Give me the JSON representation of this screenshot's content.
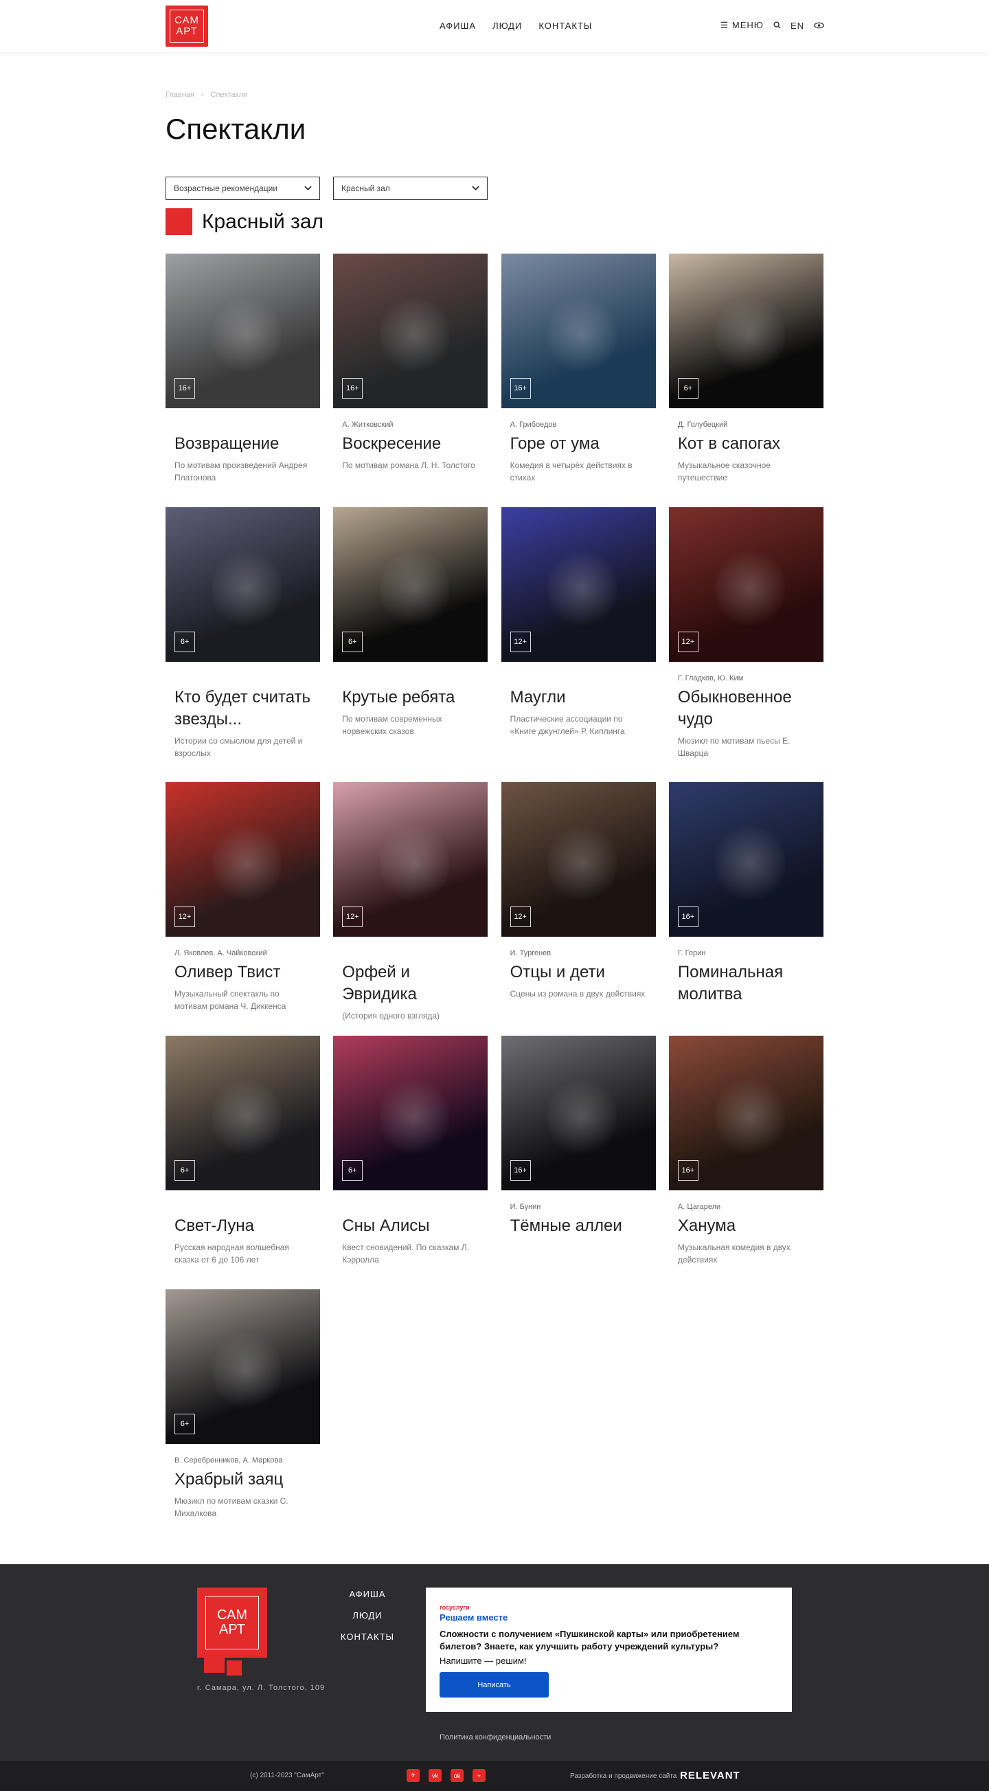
{
  "header": {
    "logo": [
      "САМ",
      "АРТ"
    ],
    "nav": [
      "АФИША",
      "ЛЮДИ",
      "КОНТАКТЫ"
    ],
    "menu": "МЕНЮ",
    "lang": "EN"
  },
  "breadcrumbs": [
    "Главная",
    "Спектакли"
  ],
  "title": "Спектакли",
  "filters": {
    "age": "Возрастные рекомендации",
    "hall": "Красный зал"
  },
  "hall_title": "Красный зал",
  "cards": [
    {
      "age": "16+",
      "author": "",
      "title": "Возвращение",
      "desc": "По мотивам произведений Андрея Платонова",
      "colors": [
        "#3a3a3a",
        "#9ea0a4"
      ]
    },
    {
      "age": "16+",
      "author": "А. Житковский",
      "title": "Воскресение",
      "desc": "По мотивам романа Л. Н. Толстого",
      "colors": [
        "#222628",
        "#6b4a46"
      ]
    },
    {
      "age": "16+",
      "author": "А. Грибоедов",
      "title": "Горе от ума",
      "desc": "Комедия в четырёх действиях в стихах",
      "colors": [
        "#1b3a55",
        "#7b8aa0"
      ]
    },
    {
      "age": "6+",
      "author": "Д. Голубецкий",
      "title": "Кот в сапогах",
      "desc": "Музыкальное сказочное путешествие",
      "colors": [
        "#0a0a0a",
        "#c9b8a3"
      ]
    },
    {
      "age": "6+",
      "author": "",
      "title": "Кто будет считать звезды...",
      "desc": "Истории со смыслом для детей и взрослых",
      "colors": [
        "#1a1c22",
        "#5d5e78"
      ]
    },
    {
      "age": "6+",
      "author": "",
      "title": "Крутые ребята",
      "desc": "По мотивам современных норвежских сказов",
      "colors": [
        "#0b0b0b",
        "#b7a790"
      ]
    },
    {
      "age": "12+",
      "author": "",
      "title": "Маугли",
      "desc": "Пластические ассоциации по «Книге джунглей» Р. Киплинга",
      "colors": [
        "#11131e",
        "#3c3fa2"
      ]
    },
    {
      "age": "12+",
      "author": "Г. Гладков, Ю. Ким",
      "title": "Обыкновенное чудо",
      "desc": "Мюзикл по мотивам пьесы Е. Шварца",
      "colors": [
        "#2a0b0b",
        "#7c2f2a"
      ]
    },
    {
      "age": "12+",
      "author": "Л. Яковлев, А. Чайковский",
      "title": "Оливер Твист",
      "desc": "Музыкальный спектакль по мотивам романа Ч. Диккенса",
      "colors": [
        "#2c1a1a",
        "#c8322a"
      ]
    },
    {
      "age": "12+",
      "author": "",
      "title": "Орфей и Эвридика",
      "desc": "(История одного взгляда)",
      "colors": [
        "#2a1215",
        "#d8a1ab"
      ]
    },
    {
      "age": "12+",
      "author": "И. Тургенев",
      "title": "Отцы и дети",
      "desc": "Сцены из романа в двух действиях",
      "colors": [
        "#1a1310",
        "#6e5443"
      ]
    },
    {
      "age": "16+",
      "author": "Г. Горин",
      "title": "Поминальная молитва",
      "desc": "",
      "colors": [
        "#0f1424",
        "#2f3c6b"
      ]
    },
    {
      "age": "6+",
      "author": "",
      "title": "Свет-Луна",
      "desc": "Русская народная волшебная сказка от 6 до 106 лет",
      "colors": [
        "#1a1a1e",
        "#8d7a63"
      ]
    },
    {
      "age": "6+",
      "author": "",
      "title": "Сны Алисы",
      "desc": "Квест сновидений. По сказкам Л. Кэрролла",
      "colors": [
        "#12081b",
        "#b13c5c"
      ]
    },
    {
      "age": "16+",
      "author": "И. Бунин",
      "title": "Тёмные аллеи",
      "desc": "",
      "colors": [
        "#0d0d10",
        "#6f6e74"
      ]
    },
    {
      "age": "16+",
      "author": "А. Цагарели",
      "title": "Ханума",
      "desc": "Музыкальная комедия в двух действиях",
      "colors": [
        "#20160f",
        "#8b4a38"
      ]
    },
    {
      "age": "6+",
      "author": "В. Серебренников, А. Маркова",
      "title": "Храбрый заяц",
      "desc": "Мюзикл по мотивам сказки С. Михалкова",
      "colors": [
        "#0f0f12",
        "#a39a92"
      ]
    }
  ],
  "footer": {
    "nav": [
      "АФИША",
      "ЛЮДИ",
      "КОНТАКТЫ"
    ],
    "address": "г. Самара, ул. Л. Толстого, 109",
    "gos_brand": "госуслуги",
    "gos_sub": "Решаем вместе",
    "gos_q": "Сложности с получением «Пушкинской карты» или приобретением билетов? Знаете, как улучшить работу учреждений культуры?",
    "gos_a": "Напишите — решим!",
    "gos_btn": "Написать",
    "privacy": "Политика конфиденциальности",
    "copyright": "(c) 2011-2023 \"СамАрт\"",
    "social": [
      "✈",
      "vk",
      "ok",
      "+"
    ],
    "dev": "Разработка и продвижение сайта",
    "dev_brand": "RELEVANT"
  },
  "accent": "#e32b2b"
}
